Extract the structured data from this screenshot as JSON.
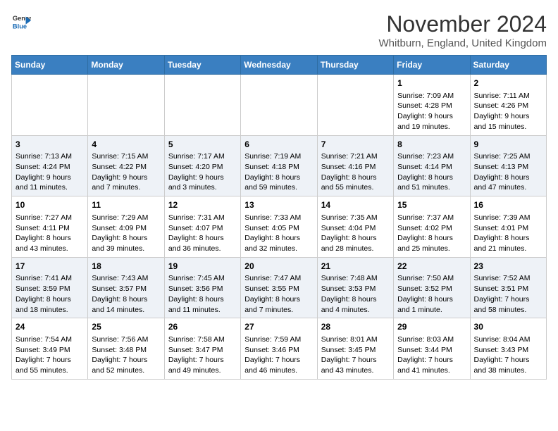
{
  "header": {
    "logo_general": "General",
    "logo_blue": "Blue",
    "month_title": "November 2024",
    "location": "Whitburn, England, United Kingdom"
  },
  "weekdays": [
    "Sunday",
    "Monday",
    "Tuesday",
    "Wednesday",
    "Thursday",
    "Friday",
    "Saturday"
  ],
  "weeks": [
    [
      {
        "day": "",
        "sunrise": "",
        "sunset": "",
        "daylight": ""
      },
      {
        "day": "",
        "sunrise": "",
        "sunset": "",
        "daylight": ""
      },
      {
        "day": "",
        "sunrise": "",
        "sunset": "",
        "daylight": ""
      },
      {
        "day": "",
        "sunrise": "",
        "sunset": "",
        "daylight": ""
      },
      {
        "day": "",
        "sunrise": "",
        "sunset": "",
        "daylight": ""
      },
      {
        "day": "1",
        "sunrise": "Sunrise: 7:09 AM",
        "sunset": "Sunset: 4:28 PM",
        "daylight": "Daylight: 9 hours and 19 minutes."
      },
      {
        "day": "2",
        "sunrise": "Sunrise: 7:11 AM",
        "sunset": "Sunset: 4:26 PM",
        "daylight": "Daylight: 9 hours and 15 minutes."
      }
    ],
    [
      {
        "day": "3",
        "sunrise": "Sunrise: 7:13 AM",
        "sunset": "Sunset: 4:24 PM",
        "daylight": "Daylight: 9 hours and 11 minutes."
      },
      {
        "day": "4",
        "sunrise": "Sunrise: 7:15 AM",
        "sunset": "Sunset: 4:22 PM",
        "daylight": "Daylight: 9 hours and 7 minutes."
      },
      {
        "day": "5",
        "sunrise": "Sunrise: 7:17 AM",
        "sunset": "Sunset: 4:20 PM",
        "daylight": "Daylight: 9 hours and 3 minutes."
      },
      {
        "day": "6",
        "sunrise": "Sunrise: 7:19 AM",
        "sunset": "Sunset: 4:18 PM",
        "daylight": "Daylight: 8 hours and 59 minutes."
      },
      {
        "day": "7",
        "sunrise": "Sunrise: 7:21 AM",
        "sunset": "Sunset: 4:16 PM",
        "daylight": "Daylight: 8 hours and 55 minutes."
      },
      {
        "day": "8",
        "sunrise": "Sunrise: 7:23 AM",
        "sunset": "Sunset: 4:14 PM",
        "daylight": "Daylight: 8 hours and 51 minutes."
      },
      {
        "day": "9",
        "sunrise": "Sunrise: 7:25 AM",
        "sunset": "Sunset: 4:13 PM",
        "daylight": "Daylight: 8 hours and 47 minutes."
      }
    ],
    [
      {
        "day": "10",
        "sunrise": "Sunrise: 7:27 AM",
        "sunset": "Sunset: 4:11 PM",
        "daylight": "Daylight: 8 hours and 43 minutes."
      },
      {
        "day": "11",
        "sunrise": "Sunrise: 7:29 AM",
        "sunset": "Sunset: 4:09 PM",
        "daylight": "Daylight: 8 hours and 39 minutes."
      },
      {
        "day": "12",
        "sunrise": "Sunrise: 7:31 AM",
        "sunset": "Sunset: 4:07 PM",
        "daylight": "Daylight: 8 hours and 36 minutes."
      },
      {
        "day": "13",
        "sunrise": "Sunrise: 7:33 AM",
        "sunset": "Sunset: 4:05 PM",
        "daylight": "Daylight: 8 hours and 32 minutes."
      },
      {
        "day": "14",
        "sunrise": "Sunrise: 7:35 AM",
        "sunset": "Sunset: 4:04 PM",
        "daylight": "Daylight: 8 hours and 28 minutes."
      },
      {
        "day": "15",
        "sunrise": "Sunrise: 7:37 AM",
        "sunset": "Sunset: 4:02 PM",
        "daylight": "Daylight: 8 hours and 25 minutes."
      },
      {
        "day": "16",
        "sunrise": "Sunrise: 7:39 AM",
        "sunset": "Sunset: 4:01 PM",
        "daylight": "Daylight: 8 hours and 21 minutes."
      }
    ],
    [
      {
        "day": "17",
        "sunrise": "Sunrise: 7:41 AM",
        "sunset": "Sunset: 3:59 PM",
        "daylight": "Daylight: 8 hours and 18 minutes."
      },
      {
        "day": "18",
        "sunrise": "Sunrise: 7:43 AM",
        "sunset": "Sunset: 3:57 PM",
        "daylight": "Daylight: 8 hours and 14 minutes."
      },
      {
        "day": "19",
        "sunrise": "Sunrise: 7:45 AM",
        "sunset": "Sunset: 3:56 PM",
        "daylight": "Daylight: 8 hours and 11 minutes."
      },
      {
        "day": "20",
        "sunrise": "Sunrise: 7:47 AM",
        "sunset": "Sunset: 3:55 PM",
        "daylight": "Daylight: 8 hours and 7 minutes."
      },
      {
        "day": "21",
        "sunrise": "Sunrise: 7:48 AM",
        "sunset": "Sunset: 3:53 PM",
        "daylight": "Daylight: 8 hours and 4 minutes."
      },
      {
        "day": "22",
        "sunrise": "Sunrise: 7:50 AM",
        "sunset": "Sunset: 3:52 PM",
        "daylight": "Daylight: 8 hours and 1 minute."
      },
      {
        "day": "23",
        "sunrise": "Sunrise: 7:52 AM",
        "sunset": "Sunset: 3:51 PM",
        "daylight": "Daylight: 7 hours and 58 minutes."
      }
    ],
    [
      {
        "day": "24",
        "sunrise": "Sunrise: 7:54 AM",
        "sunset": "Sunset: 3:49 PM",
        "daylight": "Daylight: 7 hours and 55 minutes."
      },
      {
        "day": "25",
        "sunrise": "Sunrise: 7:56 AM",
        "sunset": "Sunset: 3:48 PM",
        "daylight": "Daylight: 7 hours and 52 minutes."
      },
      {
        "day": "26",
        "sunrise": "Sunrise: 7:58 AM",
        "sunset": "Sunset: 3:47 PM",
        "daylight": "Daylight: 7 hours and 49 minutes."
      },
      {
        "day": "27",
        "sunrise": "Sunrise: 7:59 AM",
        "sunset": "Sunset: 3:46 PM",
        "daylight": "Daylight: 7 hours and 46 minutes."
      },
      {
        "day": "28",
        "sunrise": "Sunrise: 8:01 AM",
        "sunset": "Sunset: 3:45 PM",
        "daylight": "Daylight: 7 hours and 43 minutes."
      },
      {
        "day": "29",
        "sunrise": "Sunrise: 8:03 AM",
        "sunset": "Sunset: 3:44 PM",
        "daylight": "Daylight: 7 hours and 41 minutes."
      },
      {
        "day": "30",
        "sunrise": "Sunrise: 8:04 AM",
        "sunset": "Sunset: 3:43 PM",
        "daylight": "Daylight: 7 hours and 38 minutes."
      }
    ]
  ]
}
